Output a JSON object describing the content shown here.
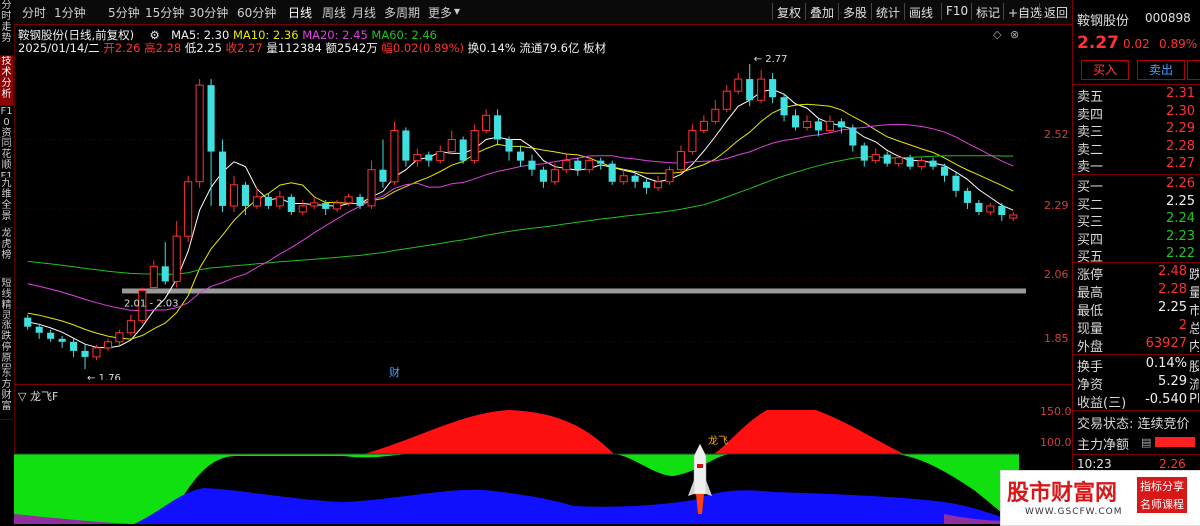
{
  "left_tabs": [
    "分时走势",
    "技术分析",
    "F10资料",
    "同花顺F10",
    "九维全景",
    "龙虎榜",
    "短线精灵",
    "涨跌停原因",
    "东方财富"
  ],
  "toolbar": {
    "periods": [
      "分时",
      "1分钟",
      "5分钟",
      "15分钟",
      "30分钟",
      "60分钟",
      "日线",
      "周线",
      "月线",
      "多周期",
      "更多"
    ],
    "tools": [
      "复权",
      "叠加",
      "多股",
      "统计",
      "画线",
      "F10",
      "标记",
      "+自选",
      "返回"
    ]
  },
  "stock": {
    "name_line": "鞍钢股份(日线,前复权)",
    "date": "2025/01/14/二",
    "open_label": "开",
    "open": "2.26",
    "high_label": "高",
    "high": "2.28",
    "low_label": "低",
    "low": "2.25",
    "close_label": "收",
    "close": "2.27",
    "vol_label": "量",
    "vol": "112384",
    "amt_label": "额",
    "amt": "2542万",
    "chg_label": "幅",
    "chg": "0.02(0.89%)",
    "turnover": "换0.14%",
    "float": "流通79.6亿",
    "board": "板材"
  },
  "ma": {
    "ma5": "MA5: 2.30",
    "ma10": "MA10: 2.36",
    "ma20": "MA20: 2.45",
    "ma60": "MA60: 2.46",
    "colors": {
      "ma5": "#ffffff",
      "ma10": "#e8e800",
      "ma20": "#e040e0",
      "ma60": "#20c020"
    }
  },
  "price_axis": [
    "2.52",
    "2.29",
    "2.06",
    "1.85"
  ],
  "annotations": {
    "high": "2.77",
    "low": "1.76",
    "band": "2.01 - 2.03",
    "cai": "财"
  },
  "indicator": {
    "name": "龙飞F",
    "axis": [
      "150.0",
      "100.0"
    ],
    "rocket_label": "龙飞"
  },
  "quote": {
    "name": "鞍钢股份",
    "code": "000898",
    "price": "2.27",
    "change": "0.02",
    "pct": "0.89%",
    "buy_btn": "买入",
    "sell_btn": "卖出",
    "asks": [
      {
        "label": "卖五",
        "price": "2.31"
      },
      {
        "label": "卖四",
        "price": "2.30"
      },
      {
        "label": "卖三",
        "price": "2.29"
      },
      {
        "label": "卖二",
        "price": "2.28"
      },
      {
        "label": "卖一",
        "price": "2.27"
      }
    ],
    "bids": [
      {
        "label": "买一",
        "price": "2.26"
      },
      {
        "label": "买二",
        "price": "2.25"
      },
      {
        "label": "买三",
        "price": "2.24"
      },
      {
        "label": "买四",
        "price": "2.23"
      },
      {
        "label": "买五",
        "price": "2.22"
      }
    ],
    "stats": [
      {
        "label": "涨停",
        "value": "2.48",
        "tail": "跌"
      },
      {
        "label": "最高",
        "value": "2.28",
        "tail": "量"
      },
      {
        "label": "最低",
        "value": "2.25",
        "tail": "市"
      },
      {
        "label": "现量",
        "value": "2",
        "tail": "总"
      },
      {
        "label": "外盘",
        "value": "63927",
        "tail": "内"
      }
    ],
    "stats2": [
      {
        "label": "换手",
        "value": "0.14%",
        "tail": "股"
      },
      {
        "label": "净资",
        "value": "5.29",
        "tail": "流"
      },
      {
        "label": "收益(三)",
        "value": "-0.540",
        "tail": "PE"
      }
    ],
    "trade_state": "交易状态: 连续竞价",
    "main_net": "主力净额",
    "time": "10:23",
    "time_price": "2.26"
  },
  "watermark": {
    "title": "股市财富网",
    "tag1": "指标分享",
    "tag2": "名师课程",
    "url": "WWW.GSCFW.COM"
  },
  "chart_data": {
    "type": "candlestick",
    "title": "鞍钢股份(日线,前复权)",
    "y_range": [
      1.7,
      2.85
    ],
    "candles": [
      [
        1.93,
        1.9,
        1.94,
        1.89
      ],
      [
        1.9,
        1.88,
        1.91,
        1.86
      ],
      [
        1.88,
        1.86,
        1.89,
        1.85
      ],
      [
        1.86,
        1.85,
        1.87,
        1.83
      ],
      [
        1.85,
        1.82,
        1.86,
        1.8
      ],
      [
        1.82,
        1.8,
        1.84,
        1.76
      ],
      [
        1.8,
        1.83,
        1.84,
        1.79
      ],
      [
        1.83,
        1.85,
        1.86,
        1.82
      ],
      [
        1.85,
        1.88,
        1.89,
        1.84
      ],
      [
        1.88,
        1.92,
        1.94,
        1.87
      ],
      [
        1.92,
        2.02,
        2.03,
        1.91
      ],
      [
        2.03,
        2.1,
        2.12,
        2.02
      ],
      [
        2.1,
        2.05,
        2.18,
        2.04
      ],
      [
        2.05,
        2.2,
        2.25,
        2.03
      ],
      [
        2.2,
        2.38,
        2.4,
        2.18
      ],
      [
        2.38,
        2.7,
        2.72,
        2.36
      ],
      [
        2.7,
        2.48,
        2.72,
        2.3
      ],
      [
        2.48,
        2.3,
        2.52,
        2.28
      ],
      [
        2.3,
        2.37,
        2.4,
        2.28
      ],
      [
        2.37,
        2.3,
        2.38,
        2.27
      ],
      [
        2.3,
        2.33,
        2.36,
        2.29
      ],
      [
        2.33,
        2.3,
        2.34,
        2.29
      ],
      [
        2.3,
        2.33,
        2.35,
        2.29
      ],
      [
        2.33,
        2.28,
        2.34,
        2.27
      ],
      [
        2.28,
        2.3,
        2.32,
        2.27
      ],
      [
        2.3,
        2.31,
        2.33,
        2.29
      ],
      [
        2.31,
        2.29,
        2.32,
        2.27
      ],
      [
        2.29,
        2.31,
        2.32,
        2.28
      ],
      [
        2.31,
        2.33,
        2.34,
        2.3
      ],
      [
        2.33,
        2.3,
        2.34,
        2.29
      ],
      [
        2.3,
        2.42,
        2.45,
        2.29
      ],
      [
        2.42,
        2.38,
        2.52,
        2.36
      ],
      [
        2.38,
        2.55,
        2.58,
        2.37
      ],
      [
        2.55,
        2.45,
        2.56,
        2.43
      ],
      [
        2.45,
        2.47,
        2.49,
        2.43
      ],
      [
        2.47,
        2.45,
        2.48,
        2.43
      ],
      [
        2.45,
        2.48,
        2.5,
        2.44
      ],
      [
        2.48,
        2.52,
        2.55,
        2.47
      ],
      [
        2.52,
        2.45,
        2.53,
        2.44
      ],
      [
        2.45,
        2.55,
        2.57,
        2.44
      ],
      [
        2.55,
        2.6,
        2.62,
        2.54
      ],
      [
        2.6,
        2.52,
        2.62,
        2.5
      ],
      [
        2.52,
        2.48,
        2.53,
        2.45
      ],
      [
        2.48,
        2.45,
        2.5,
        2.43
      ],
      [
        2.45,
        2.42,
        2.47,
        2.4
      ],
      [
        2.42,
        2.38,
        2.43,
        2.36
      ],
      [
        2.38,
        2.42,
        2.44,
        2.37
      ],
      [
        2.42,
        2.45,
        2.47,
        2.41
      ],
      [
        2.45,
        2.42,
        2.46,
        2.4
      ],
      [
        2.42,
        2.45,
        2.46,
        2.41
      ],
      [
        2.45,
        2.44,
        2.46,
        2.42
      ],
      [
        2.44,
        2.38,
        2.45,
        2.37
      ],
      [
        2.38,
        2.4,
        2.42,
        2.37
      ],
      [
        2.4,
        2.38,
        2.41,
        2.36
      ],
      [
        2.38,
        2.36,
        2.39,
        2.34
      ],
      [
        2.36,
        2.38,
        2.4,
        2.35
      ],
      [
        2.38,
        2.42,
        2.43,
        2.37
      ],
      [
        2.42,
        2.48,
        2.5,
        2.41
      ],
      [
        2.48,
        2.55,
        2.57,
        2.47
      ],
      [
        2.55,
        2.58,
        2.6,
        2.54
      ],
      [
        2.58,
        2.62,
        2.65,
        2.57
      ],
      [
        2.62,
        2.68,
        2.7,
        2.61
      ],
      [
        2.68,
        2.72,
        2.74,
        2.67
      ],
      [
        2.72,
        2.65,
        2.77,
        2.63
      ],
      [
        2.65,
        2.72,
        2.75,
        2.64
      ],
      [
        2.72,
        2.66,
        2.74,
        2.64
      ],
      [
        2.66,
        2.6,
        2.67,
        2.58
      ],
      [
        2.6,
        2.56,
        2.62,
        2.55
      ],
      [
        2.56,
        2.58,
        2.6,
        2.55
      ],
      [
        2.58,
        2.55,
        2.59,
        2.53
      ],
      [
        2.55,
        2.58,
        2.6,
        2.54
      ],
      [
        2.58,
        2.56,
        2.59,
        2.54
      ],
      [
        2.56,
        2.5,
        2.57,
        2.48
      ],
      [
        2.5,
        2.45,
        2.51,
        2.43
      ],
      [
        2.45,
        2.47,
        2.49,
        2.44
      ],
      [
        2.47,
        2.44,
        2.48,
        2.43
      ],
      [
        2.44,
        2.46,
        2.47,
        2.43
      ],
      [
        2.46,
        2.43,
        2.47,
        2.42
      ],
      [
        2.43,
        2.45,
        2.46,
        2.42
      ],
      [
        2.45,
        2.43,
        2.46,
        2.42
      ],
      [
        2.43,
        2.4,
        2.44,
        2.38
      ],
      [
        2.4,
        2.35,
        2.41,
        2.33
      ],
      [
        2.35,
        2.31,
        2.36,
        2.29
      ],
      [
        2.31,
        2.28,
        2.32,
        2.27
      ],
      [
        2.28,
        2.3,
        2.31,
        2.27
      ],
      [
        2.3,
        2.27,
        2.31,
        2.25
      ],
      [
        2.26,
        2.27,
        2.28,
        2.25
      ]
    ]
  }
}
